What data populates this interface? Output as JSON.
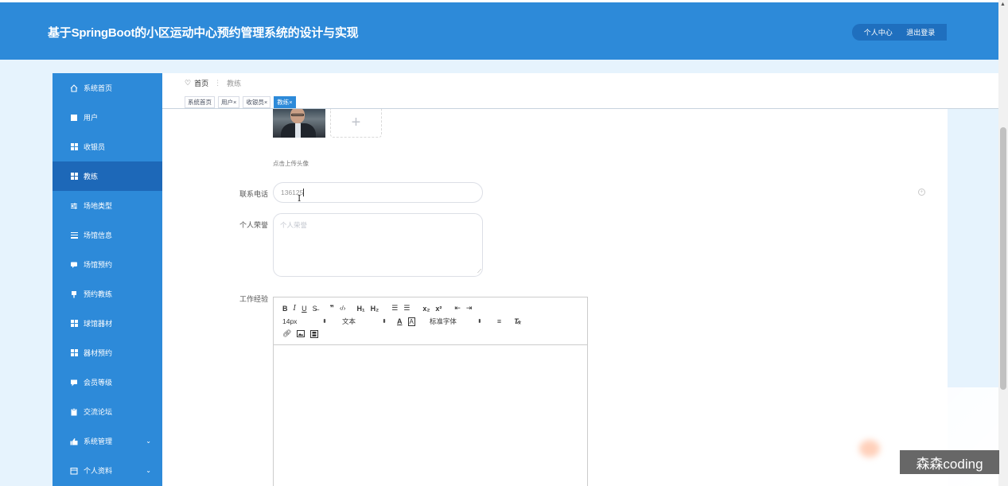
{
  "header": {
    "title": "基于SpringBoot的小区运动中心预约管理系统的设计与实现",
    "profile_link": "个人中心",
    "logout_link": "退出登录"
  },
  "sidebar": {
    "items": [
      {
        "label": "系统首页"
      },
      {
        "label": "用户"
      },
      {
        "label": "收银员"
      },
      {
        "label": "教练"
      },
      {
        "label": "场地类型"
      },
      {
        "label": "场馆信息"
      },
      {
        "label": "场馆预约"
      },
      {
        "label": "预约教练"
      },
      {
        "label": "球馆器材"
      },
      {
        "label": "器材预约"
      },
      {
        "label": "会员等级"
      },
      {
        "label": "交流论坛"
      },
      {
        "label": "系统管理"
      },
      {
        "label": "个人资料"
      }
    ],
    "active_index": 3
  },
  "breadcrumb": {
    "home": "首页",
    "separator": "⋮",
    "current": "教练"
  },
  "tabs": [
    {
      "label": "系统首页",
      "closable": false
    },
    {
      "label": "用户",
      "closable": true
    },
    {
      "label": "收银员",
      "closable": true
    },
    {
      "label": "教练",
      "closable": true
    }
  ],
  "form": {
    "upload_hint": "点击上传头像",
    "phone_label": "联系电话",
    "phone_value": "136125",
    "honor_label": "个人荣誉",
    "honor_placeholder": "个人荣誉",
    "experience_label": "工作经验"
  },
  "editor": {
    "font_size": "14px",
    "text_type": "文本",
    "font_family": "标准字体"
  },
  "watermark": "森森coding",
  "colors": {
    "primary": "#2d8ad9",
    "active": "#1d68b8"
  }
}
